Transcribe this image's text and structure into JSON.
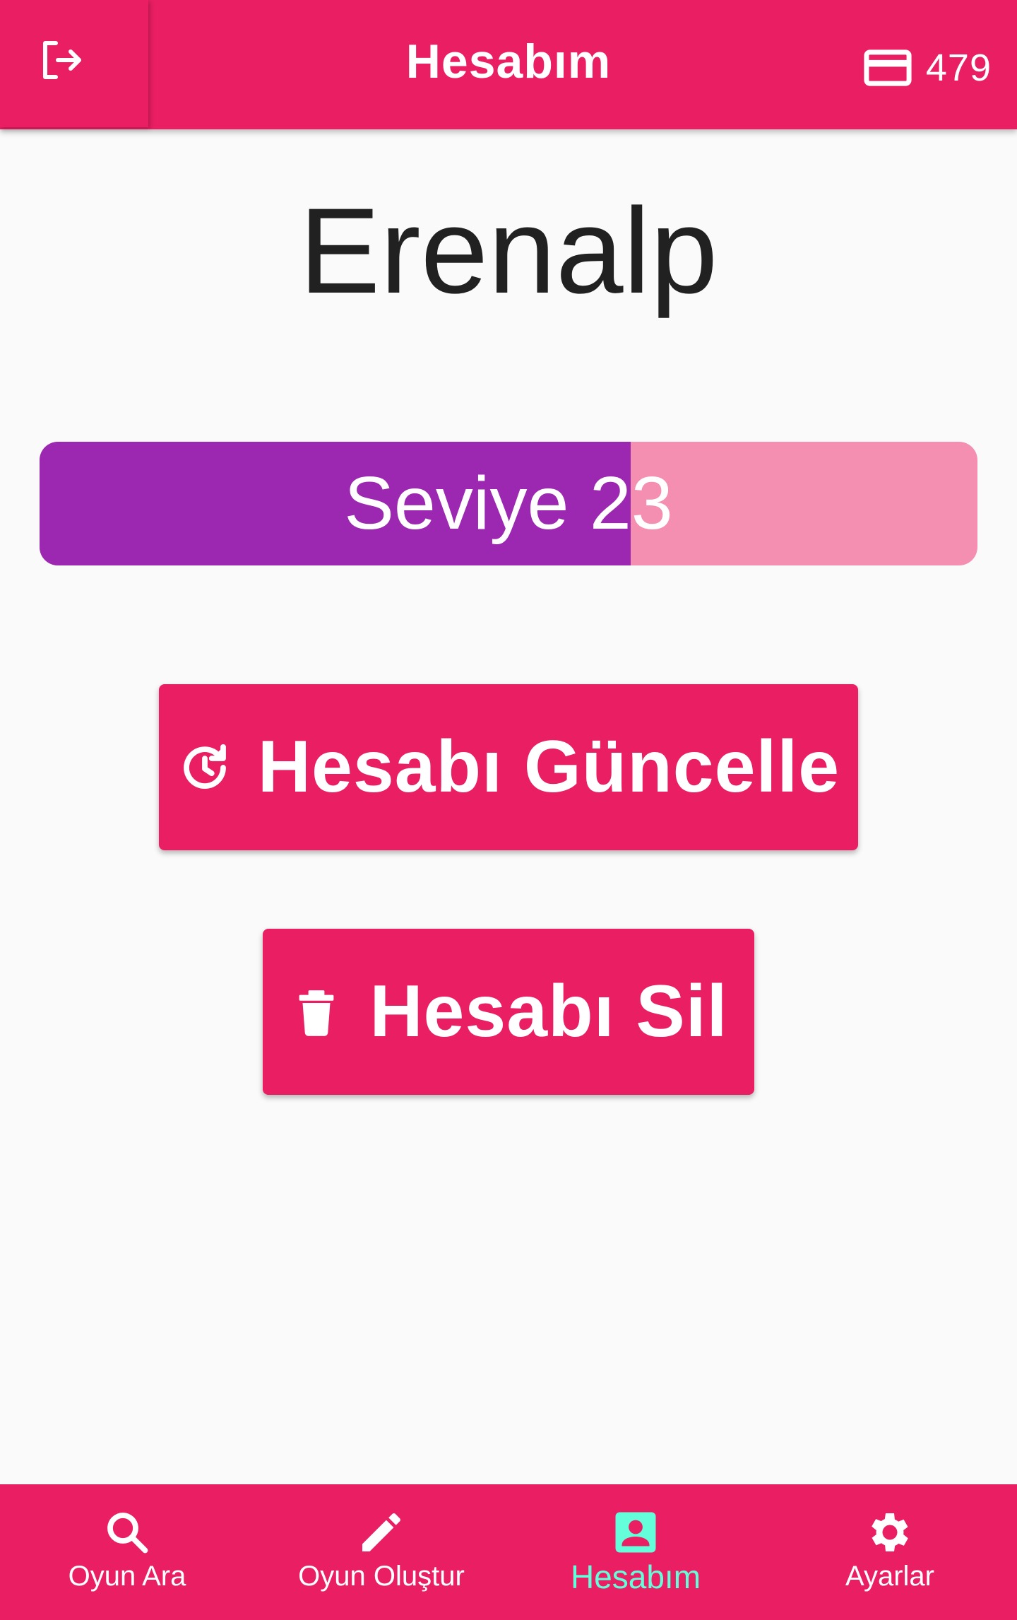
{
  "header": {
    "title": "Hesabım",
    "logout_icon": "logout-icon",
    "balance_icon": "credit-card-icon",
    "balance": "479"
  },
  "profile": {
    "username": "Erenalp",
    "level_label": "Seviye 23",
    "level_progress_percent": 63
  },
  "actions": {
    "update_label": "Hesabı Güncelle",
    "update_icon": "restore-clock-icon",
    "delete_label": "Hesabı Sil",
    "delete_icon": "trash-icon"
  },
  "bottom_nav": {
    "items": [
      {
        "label": "Oyun Ara",
        "icon": "search-icon",
        "active": false
      },
      {
        "label": "Oyun Oluştur",
        "icon": "pencil-icon",
        "active": false
      },
      {
        "label": "Hesabım",
        "icon": "account-box-icon",
        "active": true
      },
      {
        "label": "Ayarlar",
        "icon": "gear-icon",
        "active": false
      }
    ]
  },
  "colors": {
    "primary": "#e91e63",
    "level_fill": "#9c27b0",
    "level_track": "#f48fb1",
    "active_nav": "#64ffda",
    "background": "#fafafa"
  }
}
